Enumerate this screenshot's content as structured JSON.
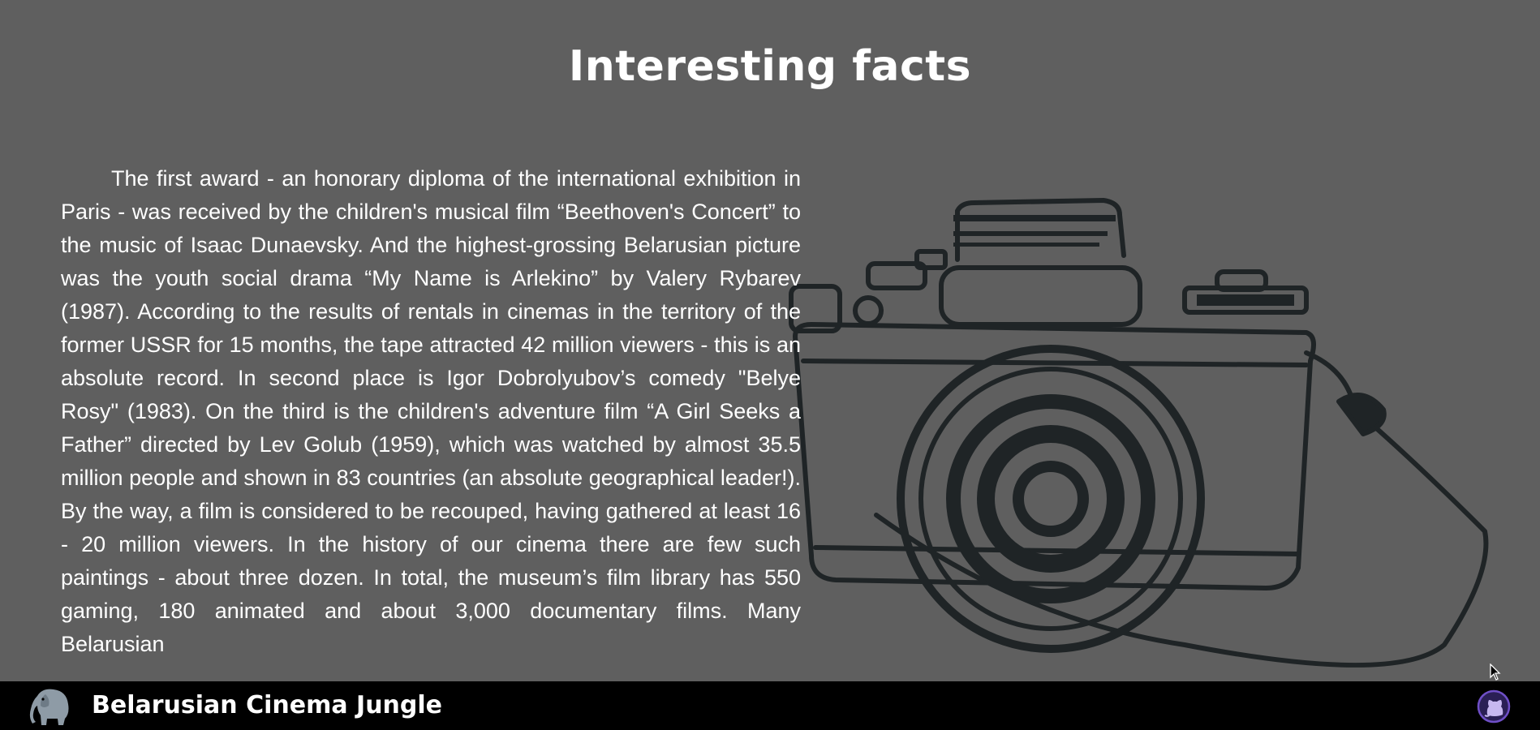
{
  "header": {
    "title": "Interesting facts"
  },
  "main": {
    "paragraph": "The first award - an honorary diploma of the international exhibition in Paris - was received by the children's musical film “Beethoven's Concert” to the music of Isaac Dunaevsky. And the highest-grossing Belarusian picture was the youth social drama “My Name is Arlekino” by Valery Rybarev (1987). According to the results of rentals in cinemas in the territory of the former USSR for 15 months, the tape attracted 42 million viewers - this is an absolute record. In second place is Igor Dobrolyubov’s comedy \"Belye Rosy\" (1983). On the third is the children's adventure film “A Girl Seeks a Father” directed by Lev Golub (1959), which was watched by almost 35.5 million people and shown in 83 countries (an absolute geographical leader!). By the way, a film is considered to be recouped, having gathered at least 16 - 20 million viewers. In the history of our cinema there are few such paintings - about three dozen. In total, the museum’s film library has 550 gaming, 180 animated and about 3,000 documentary films. Many Belarusian",
    "illustration_icon": "camera-illustration"
  },
  "footer": {
    "brand": "Belarusian Cinema Jungle",
    "logo_icon": "elephant-logo-icon",
    "github_icon": "github-icon"
  },
  "colors": {
    "background": "#5f5f5f",
    "footer": "#000000",
    "text": "#ffffff",
    "illustration": "#1f2426",
    "github_accent": "#6f4fc7"
  }
}
